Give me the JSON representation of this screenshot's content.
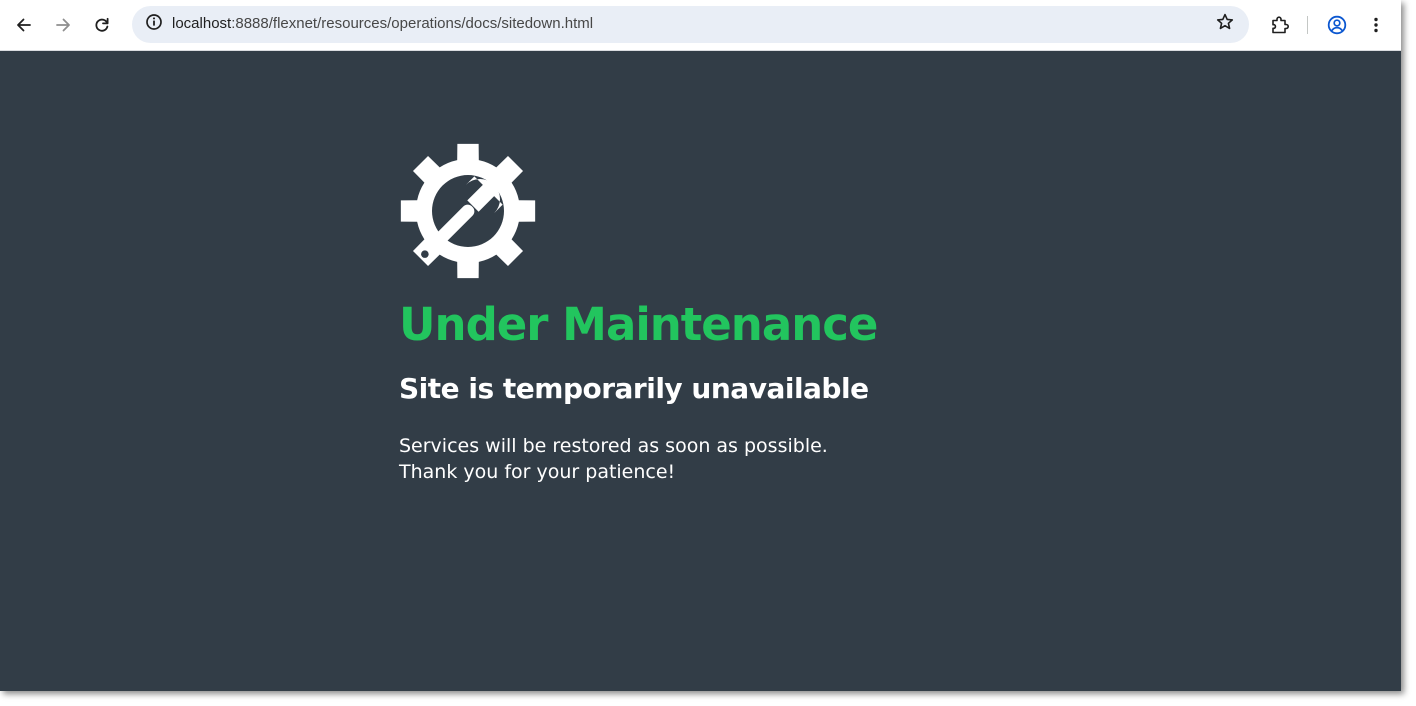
{
  "browser": {
    "url_host": "localhost",
    "url_rest": ":8888/flexnet/resources/operations/docs/sitedown.html",
    "icons": {
      "back": "arrow-left-icon",
      "forward": "arrow-right-icon",
      "reload": "reload-icon",
      "site_info": "info-icon",
      "bookmark": "star-icon",
      "extensions": "puzzle-icon",
      "profile": "account-circle-icon",
      "menu": "more-vertical-icon"
    }
  },
  "page": {
    "background_color": "#323d47",
    "accent_color": "#22c55e",
    "icon": "gear-wrench-icon",
    "title": "Under Maintenance",
    "subtitle": "Site is temporarily unavailable",
    "message_line1": "Services will be restored as soon as possible.",
    "message_line2": "Thank you for your patience!"
  }
}
